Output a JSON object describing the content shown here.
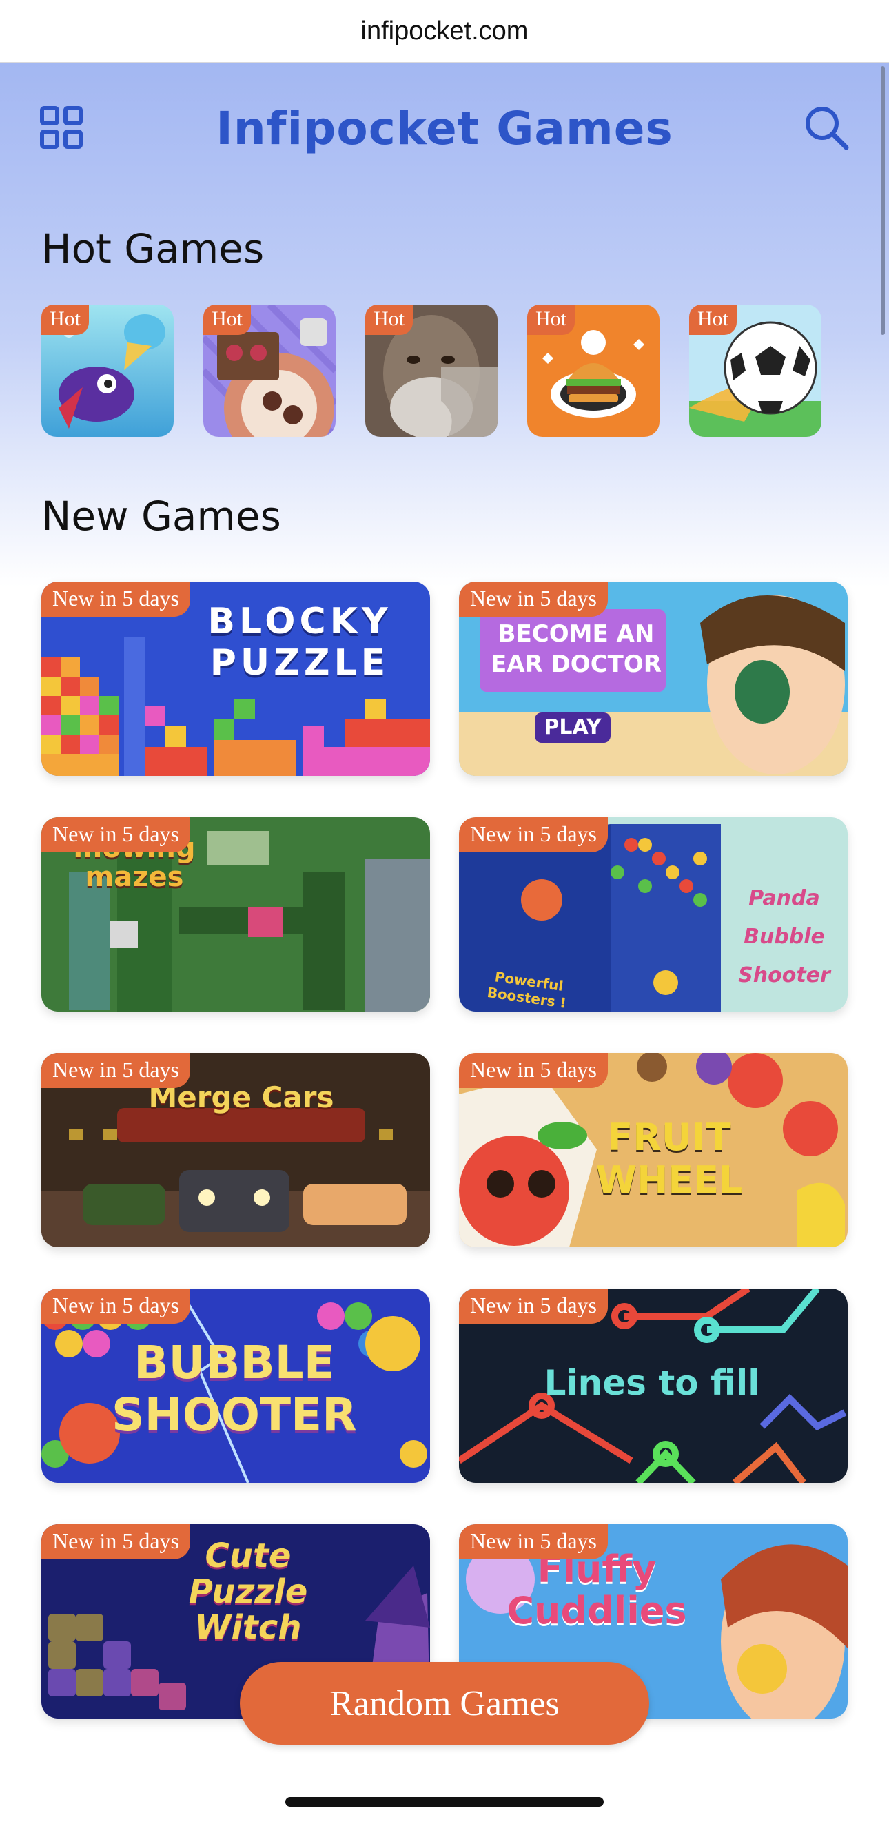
{
  "browser": {
    "url": "infipocket.com"
  },
  "header": {
    "brand": "Infipocket Games",
    "menu_icon": "grid-menu-icon",
    "search_icon": "search-icon"
  },
  "hot_section": {
    "title": "Hot Games",
    "items": [
      {
        "badge": "Hot"
      },
      {
        "badge": "Hot"
      },
      {
        "badge": "Hot"
      },
      {
        "badge": "Hot"
      },
      {
        "badge": "Hot"
      }
    ]
  },
  "new_section": {
    "title": "New Games",
    "cards": [
      {
        "badge": "New in 5 days",
        "title": "BLOCKY PUZZLE",
        "color": "#2f4fd0"
      },
      {
        "badge": "New in 5 days",
        "title": "BECOME AN EAR DOCTOR",
        "cta": "PLAY",
        "color": "#58b9e8"
      },
      {
        "badge": "New in 5 days",
        "title": "mowing mazes",
        "color": "#3e7a3a"
      },
      {
        "badge": "New in 5 days",
        "title": "Panda Bubble Shooter",
        "subtitle": "Powerful Boosters !",
        "color": "#bfe5df"
      },
      {
        "badge": "New in 5 days",
        "title": "Merge Cars",
        "color": "#3a2a1e"
      },
      {
        "badge": "New in 5 days",
        "title": "FRUIT WHEEL",
        "color": "#e9b86a"
      },
      {
        "badge": "New in 5 days",
        "title": "BUBBLE SHOOTER",
        "color": "#2a3cc0"
      },
      {
        "badge": "New in 5 days",
        "title": "Lines to fill",
        "color": "#141e2e"
      },
      {
        "badge": "New in 5 days",
        "title": "Cute Puzzle Witch",
        "color": "#1b1f6e"
      },
      {
        "badge": "New in 5 days",
        "title": "Fluffy Cuddlies",
        "color": "#52a6e8"
      }
    ]
  },
  "random_button": "Random Games"
}
